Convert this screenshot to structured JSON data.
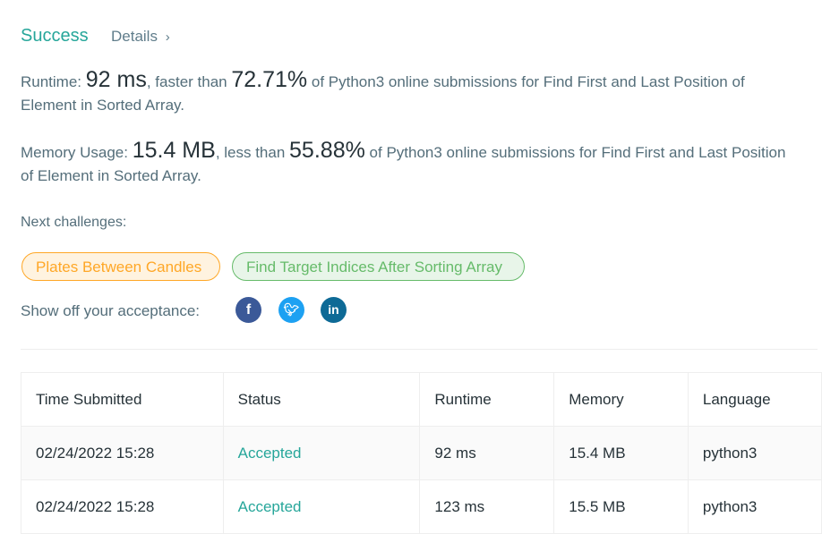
{
  "result": {
    "status": "Success",
    "details_label": "Details",
    "details_icon": "chevron-right-icon"
  },
  "runtime": {
    "label": "Runtime: ",
    "value": "92 ms",
    "mid": ", faster than ",
    "percent": "72.71%",
    "tail": " of Python3 online submissions for Find First and Last Position of Element in Sorted Array."
  },
  "memory": {
    "label": "Memory Usage: ",
    "value": "15.4 MB",
    "mid": ", less than ",
    "percent": "55.88%",
    "tail": " of Python3 online submissions for Find First and Last Position of Element in Sorted Array."
  },
  "next": {
    "label": "Next challenges:",
    "items": [
      "Plates Between Candles",
      "Find Target Indices After Sorting Array"
    ]
  },
  "share": {
    "label": "Show off your acceptance:",
    "icons": [
      "facebook-icon",
      "twitter-icon",
      "linkedin-icon"
    ]
  },
  "table": {
    "headers": [
      "Time Submitted",
      "Status",
      "Runtime",
      "Memory",
      "Language"
    ],
    "rows": [
      [
        "02/24/2022 15:28",
        "Accepted",
        "92 ms",
        "15.4 MB",
        "python3"
      ],
      [
        "02/24/2022 15:28",
        "Accepted",
        "123 ms",
        "15.5 MB",
        "python3"
      ]
    ]
  },
  "colors": {
    "accent": "#26a69a",
    "orange": "#ffa726",
    "green": "#66bb6a"
  }
}
